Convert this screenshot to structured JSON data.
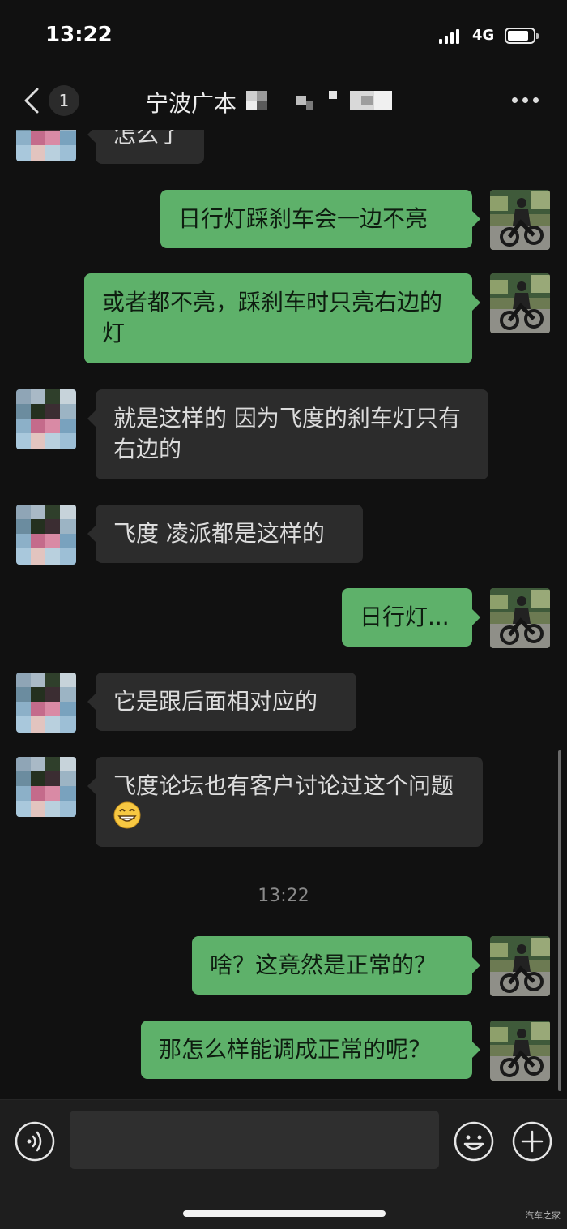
{
  "status": {
    "time": "13:22",
    "network": "4G"
  },
  "nav": {
    "badge": "1",
    "title": "宁波广本"
  },
  "messages": [
    {
      "side": "in",
      "text": "怎么了"
    },
    {
      "side": "out",
      "text": "日行灯踩刹车会一边不亮"
    },
    {
      "side": "out",
      "text": "或者都不亮，踩刹车时只亮右边的灯"
    },
    {
      "side": "in",
      "text": "就是这样的 因为飞度的刹车灯只有右边的"
    },
    {
      "side": "in",
      "text": "飞度 凌派都是这样的"
    },
    {
      "side": "out",
      "text": "日行灯..."
    },
    {
      "side": "in",
      "text": "它是跟后面相对应的"
    },
    {
      "side": "in",
      "text": "飞度论坛也有客户讨论过这个问题",
      "emoji": "grinning-emoji"
    },
    {
      "side": "out",
      "text": "啥？这竟然是正常的？"
    },
    {
      "side": "out",
      "text": "那怎么样能调成正常的呢？"
    }
  ],
  "time_divider": "13:22",
  "input": {
    "placeholder": ""
  },
  "watermark": "汽车之家",
  "colors": {
    "background": "#111111",
    "incoming_bubble": "#2c2c2c",
    "outgoing_bubble": "#5eb16a",
    "input_bar": "#1e1e1e"
  },
  "icons": [
    "back-icon",
    "more-icon",
    "voice-icon",
    "emoji-icon",
    "plus-icon",
    "avatar-self",
    "avatar-contact"
  ]
}
